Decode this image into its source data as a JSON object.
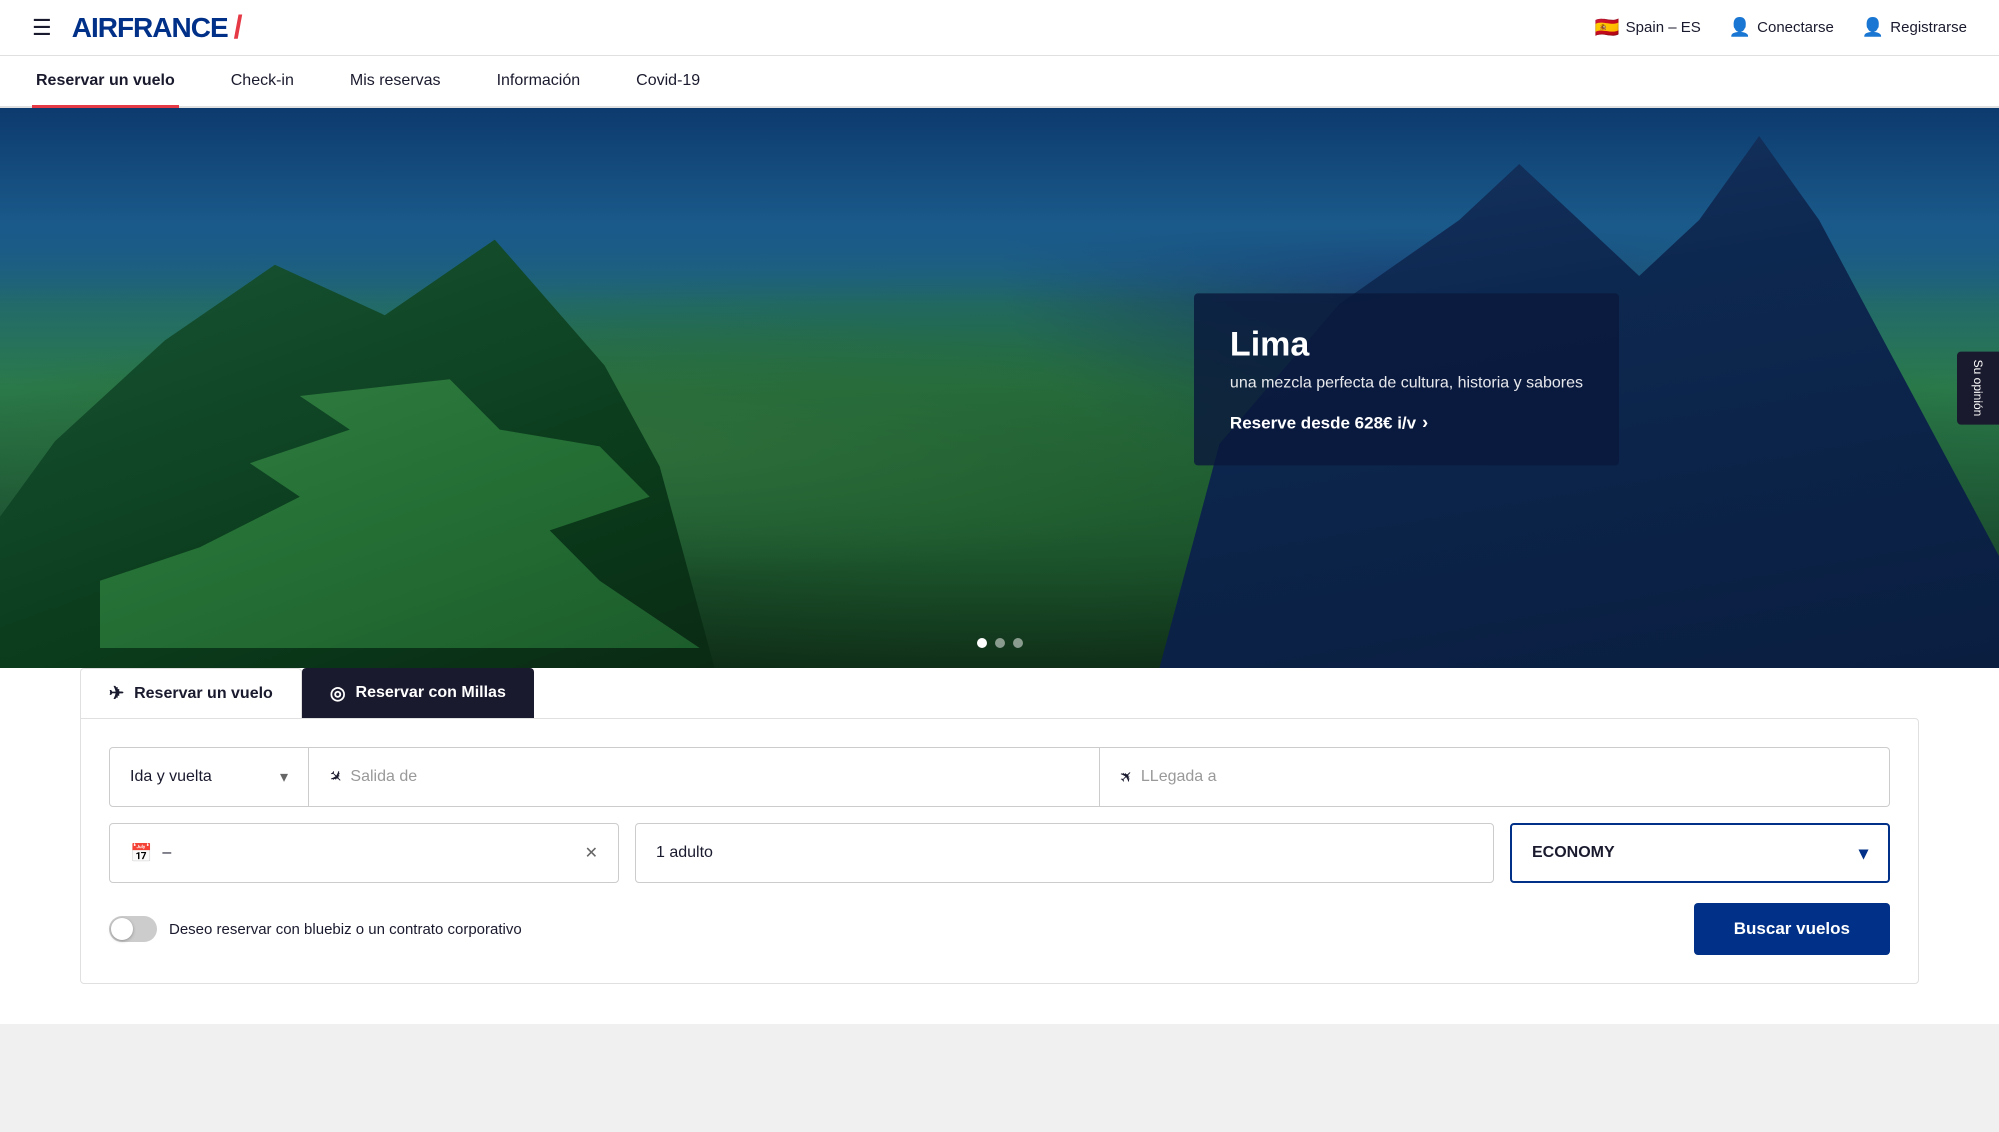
{
  "brand": {
    "name": "AIRFRANCE",
    "slash": "/"
  },
  "topnav": {
    "hamburger": "☰",
    "country": "Spain – ES",
    "flag": "🇪🇸",
    "login": "Conectarse",
    "register": "Registrarse"
  },
  "navtabs": [
    {
      "id": "reservar",
      "label": "Reservar un vuelo",
      "active": true
    },
    {
      "id": "checkin",
      "label": "Check-in",
      "active": false
    },
    {
      "id": "reservas",
      "label": "Mis reservas",
      "active": false
    },
    {
      "id": "informacion",
      "label": "Información",
      "active": false
    },
    {
      "id": "covid",
      "label": "Covid-19",
      "active": false
    }
  ],
  "hero": {
    "destination": "Lima",
    "subtitle": "una mezcla perfecta de cultura, historia y sabores",
    "price_label": "Reserve desde 628€ i/v",
    "opinion_tab": "Su opinión"
  },
  "booking": {
    "tab1_label": "Reservar un vuelo",
    "tab2_label": "Reservar con Millas",
    "trip_type": "Ida y vuelta",
    "origin_placeholder": "Salida de",
    "dest_placeholder": "LLegada a",
    "date_value": "–",
    "pax_value": "1 adulto",
    "cabin_value": "ECONOMY",
    "bluebiz_label": "Deseo reservar con bluebiz o un contrato corporativo",
    "search_label": "Buscar vuelos"
  }
}
